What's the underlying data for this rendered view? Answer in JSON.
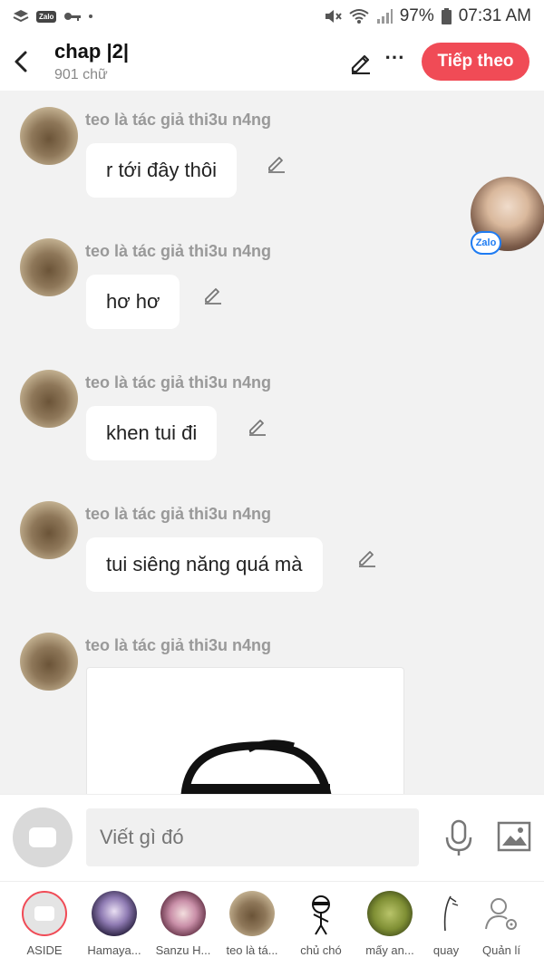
{
  "status_bar": {
    "app_badge": "Zalo",
    "battery": "97%",
    "time": "07:31 AM"
  },
  "header": {
    "title": "chap |2|",
    "word_count": "901 chữ",
    "more_icon": "⋯",
    "next_label": "Tiếp theo"
  },
  "messages": [
    {
      "author": "teo là tác giả thi3u n4ng",
      "text": "r tới đây thôi"
    },
    {
      "author": "teo là tác giả thi3u n4ng",
      "text": "hơ hơ"
    },
    {
      "author": "teo là tác giả thi3u n4ng",
      "text": "khen tui đi"
    },
    {
      "author": "teo là tác giả thi3u n4ng",
      "text": "tui siêng năng quá mà"
    },
    {
      "author": "teo là tác giả thi3u n4ng",
      "text": ""
    }
  ],
  "floating_chat": {
    "badge": "Zalo"
  },
  "composer": {
    "placeholder": "Viết gì đó"
  },
  "characters": [
    {
      "label": "ASIDE"
    },
    {
      "label": "Hamaya..."
    },
    {
      "label": "Sanzu H..."
    },
    {
      "label": "teo là tá..."
    },
    {
      "label": "chủ chó"
    },
    {
      "label": "mấy an..."
    },
    {
      "label": "quay"
    },
    {
      "label": "Quản lí"
    }
  ],
  "colors": {
    "accent": "#f04b56",
    "zalo_blue": "#1f7cf2",
    "background": "#f2f2f2"
  }
}
